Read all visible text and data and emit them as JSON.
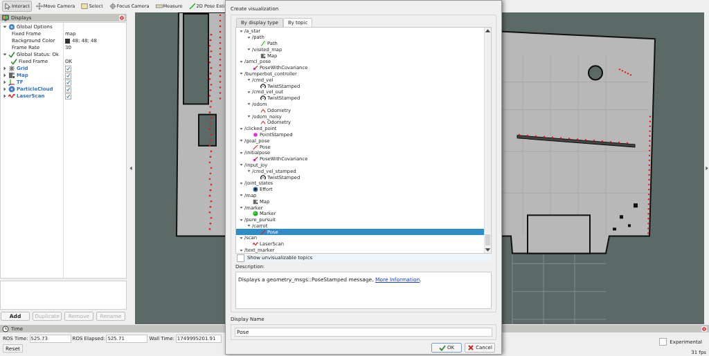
{
  "toolbar": [
    {
      "label": "Interact",
      "kind": "interact",
      "selected": true
    },
    {
      "label": "Move Camera",
      "kind": "move",
      "selected": false
    },
    {
      "label": "Select",
      "kind": "select",
      "selected": false
    },
    {
      "label": "Focus Camera",
      "kind": "focus",
      "selected": false
    },
    {
      "label": "Measure",
      "kind": "measure",
      "selected": false
    },
    {
      "label": "2D Pose Esti",
      "kind": "pose",
      "selected": false
    }
  ],
  "displays": {
    "title": "Displays",
    "items": [
      {
        "kind": "options",
        "label": "Global Options",
        "expanded": true,
        "children": [
          {
            "kind": "property",
            "label": "Fixed Frame",
            "value": "map"
          },
          {
            "kind": "colorprop",
            "label": "Background Color",
            "value": "48; 48; 48",
            "color": "#303030"
          },
          {
            "kind": "property",
            "label": "Frame Rate",
            "value": "30"
          }
        ]
      },
      {
        "kind": "status",
        "label": "Global Status: Ok",
        "expanded": true,
        "children": [
          {
            "kind": "status",
            "label": "Fixed Frame",
            "value": "OK"
          }
        ]
      },
      {
        "kind": "grid",
        "label": "Grid",
        "expanded": false,
        "checked": true
      },
      {
        "kind": "map",
        "label": "Map",
        "expanded": false,
        "checked": true
      },
      {
        "kind": "tf",
        "label": "TF",
        "expanded": false,
        "checked": true
      },
      {
        "kind": "cloud",
        "label": "ParticleCloud",
        "expanded": false,
        "checked": true
      },
      {
        "kind": "scan",
        "label": "LaserScan",
        "expanded": false,
        "checked": true
      }
    ],
    "buttons": [
      {
        "label": "Add",
        "disabled": false
      },
      {
        "label": "Duplicate",
        "disabled": true
      },
      {
        "label": "Remove",
        "disabled": true
      },
      {
        "label": "Rename",
        "disabled": true
      }
    ]
  },
  "time": {
    "title": "Time",
    "fields": [
      {
        "label": "ROS Time:",
        "value": "525.73"
      },
      {
        "label": "ROS Elapsed:",
        "value": "525.71"
      },
      {
        "label": "Wall Time:",
        "value": "1749995201.91"
      }
    ],
    "reset": "Reset",
    "experimental": {
      "label": "Experimental",
      "checked": false
    },
    "fps": "31 fps"
  },
  "dialog": {
    "title": "Create visualization",
    "tabs": [
      {
        "label": "By display type",
        "selected": false
      },
      {
        "label": "By topic",
        "selected": true
      }
    ],
    "topics": [
      {
        "kind": "topic",
        "label": "/a_star",
        "expanded": true,
        "children": [
          {
            "kind": "topic",
            "label": "/path",
            "expanded": true,
            "children": [
              {
                "kind": "path",
                "label": "Path",
                "selected": false
              }
            ]
          },
          {
            "kind": "topic",
            "label": "/visited_map",
            "expanded": true,
            "children": [
              {
                "kind": "map",
                "label": "Map",
                "selected": false
              }
            ]
          }
        ]
      },
      {
        "kind": "topic",
        "label": "/amcl_pose",
        "expanded": true,
        "children": [
          {
            "kind": "posecov",
            "label": "PoseWithCovariance",
            "selected": false
          }
        ]
      },
      {
        "kind": "topic",
        "label": "/bumperbot_controller",
        "expanded": true,
        "children": [
          {
            "kind": "topic",
            "label": "/cmd_vel",
            "expanded": true,
            "children": [
              {
                "kind": "twist",
                "label": "TwistStamped",
                "selected": false
              }
            ]
          },
          {
            "kind": "topic",
            "label": "/cmd_vel_out",
            "expanded": true,
            "children": [
              {
                "kind": "twist",
                "label": "TwistStamped",
                "selected": false
              }
            ]
          },
          {
            "kind": "topic",
            "label": "/odom",
            "expanded": true,
            "children": [
              {
                "kind": "odometry",
                "label": "Odometry",
                "selected": false
              }
            ]
          },
          {
            "kind": "topic",
            "label": "/odom_noisy",
            "expanded": true,
            "children": [
              {
                "kind": "odometry",
                "label": "Odometry",
                "selected": false
              }
            ]
          }
        ]
      },
      {
        "kind": "topic",
        "label": "/clicked_point",
        "expanded": true,
        "children": [
          {
            "kind": "point",
            "label": "PointStamped",
            "selected": false
          }
        ]
      },
      {
        "kind": "topic",
        "label": "/goal_pose",
        "expanded": true,
        "children": [
          {
            "kind": "pose",
            "label": "Pose",
            "selected": false
          }
        ]
      },
      {
        "kind": "topic",
        "label": "/initialpose",
        "expanded": true,
        "children": [
          {
            "kind": "posecov",
            "label": "PoseWithCovariance",
            "selected": false
          }
        ]
      },
      {
        "kind": "topic",
        "label": "/input_joy",
        "expanded": true,
        "children": [
          {
            "kind": "topic",
            "label": "/cmd_vel_stamped",
            "expanded": true,
            "children": [
              {
                "kind": "twist",
                "label": "TwistStamped",
                "selected": false
              }
            ]
          }
        ]
      },
      {
        "kind": "topic",
        "label": "/joint_states",
        "expanded": true,
        "children": [
          {
            "kind": "effort",
            "label": "Effort",
            "selected": false
          }
        ]
      },
      {
        "kind": "topic",
        "label": "/map",
        "expanded": true,
        "children": [
          {
            "kind": "map",
            "label": "Map",
            "selected": false
          }
        ]
      },
      {
        "kind": "topic",
        "label": "/marker",
        "expanded": true,
        "children": [
          {
            "kind": "marker",
            "label": "Marker",
            "selected": false
          }
        ]
      },
      {
        "kind": "topic",
        "label": "/pure_pursuit",
        "expanded": true,
        "children": [
          {
            "kind": "topic",
            "label": "/carrot",
            "expanded": true,
            "children": [
              {
                "kind": "pose",
                "label": "Pose",
                "selected": true
              }
            ]
          }
        ]
      },
      {
        "kind": "topic",
        "label": "/scan",
        "expanded": true,
        "children": [
          {
            "kind": "scan",
            "label": "LaserScan",
            "selected": false
          }
        ]
      },
      {
        "kind": "topic",
        "label": "/text_marker",
        "expanded": true
      }
    ],
    "show_unvisualizable": {
      "label": "Show unvisualizable topics",
      "checked": false
    },
    "description_label": "Description:",
    "description": {
      "text": "Displays a geometry_msgs::PoseStamped message.",
      "link": "More Information",
      "after": "."
    },
    "display_name_label": "Display Name",
    "display_name": "Pose",
    "buttons": [
      {
        "label": "OK",
        "kind": "ok"
      },
      {
        "label": "Cancel",
        "kind": "cancel"
      }
    ]
  }
}
